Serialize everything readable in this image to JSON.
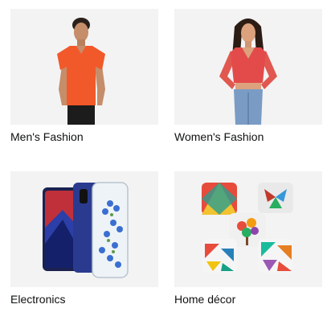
{
  "categories": [
    {
      "label": "Men's Fashion",
      "image": "man-in-orange-tshirt"
    },
    {
      "label": "Women's Fashion",
      "image": "woman-in-red-top"
    },
    {
      "label": "Electronics",
      "image": "smartphone-with-floral-case"
    },
    {
      "label": "Home décor",
      "image": "patterned-cushions"
    }
  ],
  "colors": {
    "tile_background": "#f3f3f3",
    "label_text": "#0f1111"
  }
}
